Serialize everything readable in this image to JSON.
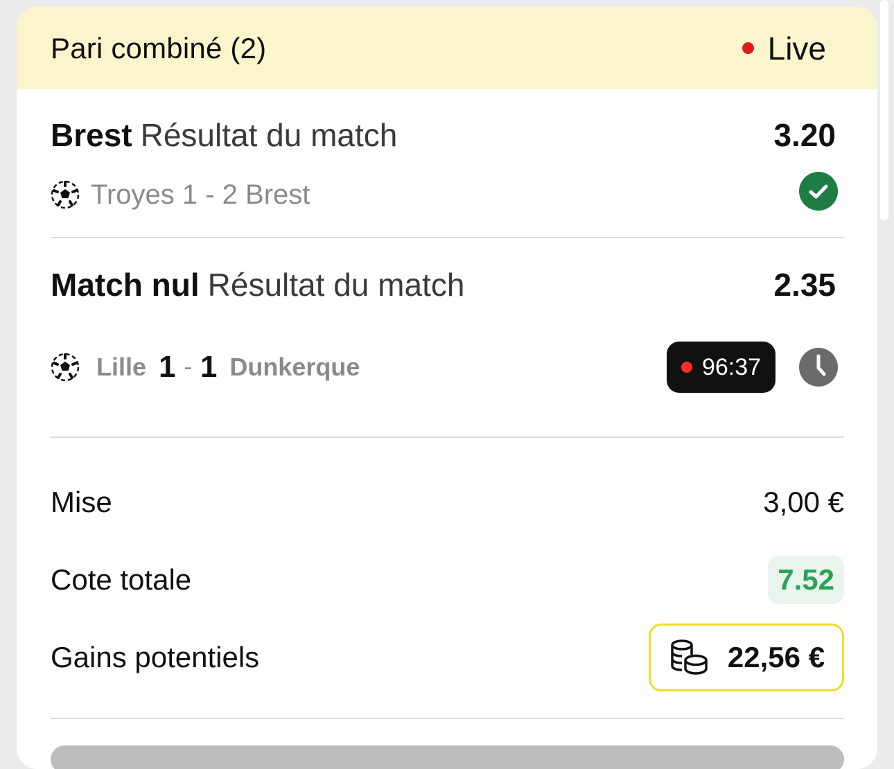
{
  "bet": {
    "title": "Pari combiné (2)",
    "live_label": "Live"
  },
  "selections": [
    {
      "pick": "Brest",
      "market": "Résultat du match",
      "odds": "3.20",
      "event": "Troyes 1 - 2 Brest",
      "status_icon": "check-icon"
    },
    {
      "pick": "Match nul",
      "market": "Résultat du match",
      "odds": "2.35",
      "home_team": "Lille",
      "home_score": "1",
      "score_separator": "-",
      "away_score": "1",
      "away_team": "Dunkerque",
      "match_time": "96:37",
      "status_icon": "clock-icon"
    }
  ],
  "summary": {
    "stake_label": "Mise",
    "stake_value": "3,00 €",
    "total_odds_label": "Cote totale",
    "total_odds_value": "7.52",
    "gains_label": "Gains potentiels",
    "gains_value": "22,56 €"
  },
  "colors": {
    "header_bg": "#faf5cc",
    "live_dot": "#e31b1b",
    "success_green": "#1e7d45",
    "total_odds_green": "#2aa35a",
    "gains_border": "#f0dc28"
  }
}
